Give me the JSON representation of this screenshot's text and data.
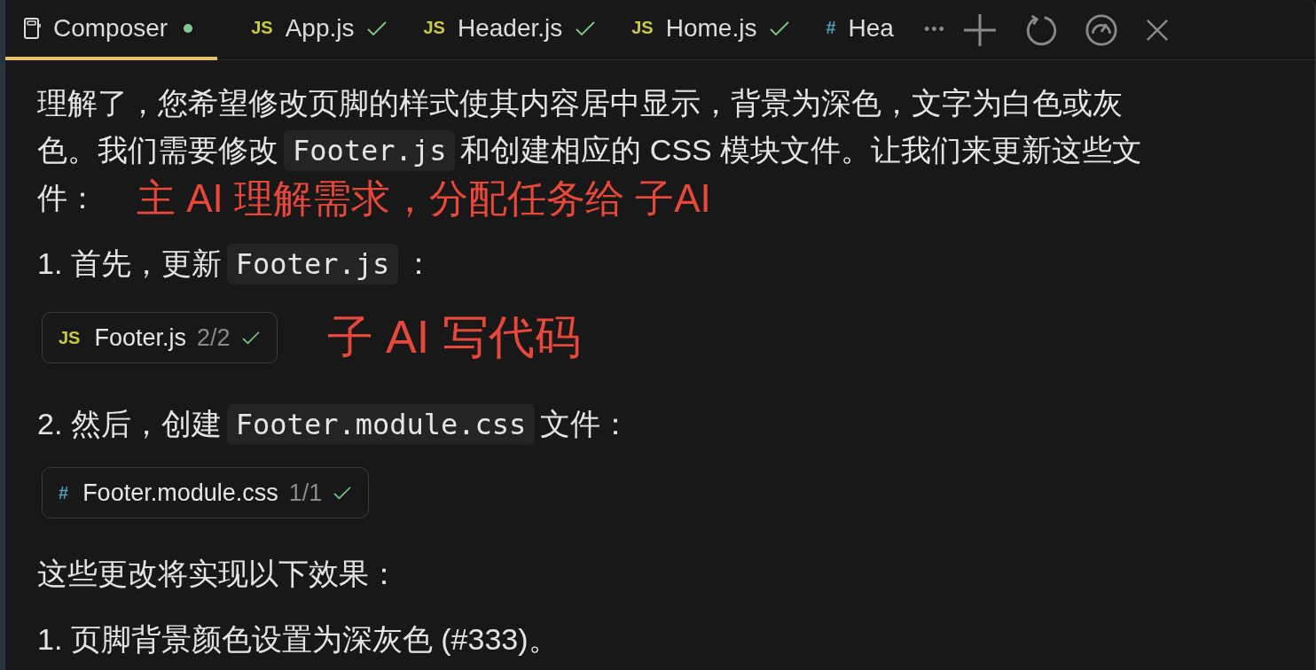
{
  "tabs": [
    {
      "kind": "composer",
      "label": "Composer",
      "selected": true,
      "unsaved": true
    },
    {
      "kind": "file",
      "color": "#cbcb41",
      "badge": "JS",
      "label": "App.js",
      "selected": false,
      "done": true
    },
    {
      "kind": "file",
      "color": "#cbcb41",
      "badge": "JS",
      "label": "Header.js",
      "selected": false,
      "done": true
    },
    {
      "kind": "file",
      "color": "#cbcb41",
      "badge": "JS",
      "label": "Home.js",
      "selected": false,
      "done": true
    },
    {
      "kind": "file",
      "color": "#519aba",
      "badge": "#",
      "label": "Hea",
      "selected": false,
      "done": false
    }
  ],
  "toolbar": {
    "more": "•••"
  },
  "blocks": [
    {
      "kind": "paragraph",
      "lines": [
        [
          {
            "kind": "text",
            "text": "理解了，您希望修改页脚的样式使其内容居中显示，背景为深色，文字为白色或灰"
          }
        ],
        [
          {
            "kind": "text",
            "text": "色。我们需要修改"
          },
          {
            "kind": "code",
            "text": "Footer.js"
          },
          {
            "kind": "text",
            "text": "和创建相应的 CSS 模块文件。让我们来更新这些文"
          }
        ],
        [
          {
            "kind": "text",
            "text": "件："
          }
        ]
      ],
      "annotation": "主 AI 理解需求，分配任务给 子AI"
    },
    {
      "kind": "paragraph",
      "lines": [
        [
          {
            "kind": "text",
            "text": "1. 首先，更新"
          },
          {
            "kind": "code",
            "text": "Footer.js"
          },
          {
            "kind": "text",
            "text": "："
          }
        ]
      ]
    },
    {
      "kind": "chip",
      "color": "#cbcb41",
      "badge": "JS",
      "name": "Footer.js",
      "count": "2/2",
      "applied": true,
      "annotation": "子 AI 写代码"
    },
    {
      "kind": "paragraph",
      "lines": [
        [
          {
            "kind": "text",
            "text": "2. 然后，创建"
          },
          {
            "kind": "code",
            "text": "Footer.module.css"
          },
          {
            "kind": "text",
            "text": "文件："
          }
        ]
      ]
    },
    {
      "kind": "chip",
      "color": "#519aba",
      "badge": "#",
      "name": "Footer.module.css",
      "count": "1/1",
      "applied": true
    },
    {
      "kind": "paragraph",
      "lines": [
        [
          {
            "kind": "text",
            "text": "这些更改将实现以下效果："
          }
        ]
      ]
    },
    {
      "kind": "paragraph",
      "lines": [
        [
          {
            "kind": "text",
            "text": "1. 页脚背景颜色设置为深灰色 (#333)。"
          }
        ]
      ]
    }
  ]
}
